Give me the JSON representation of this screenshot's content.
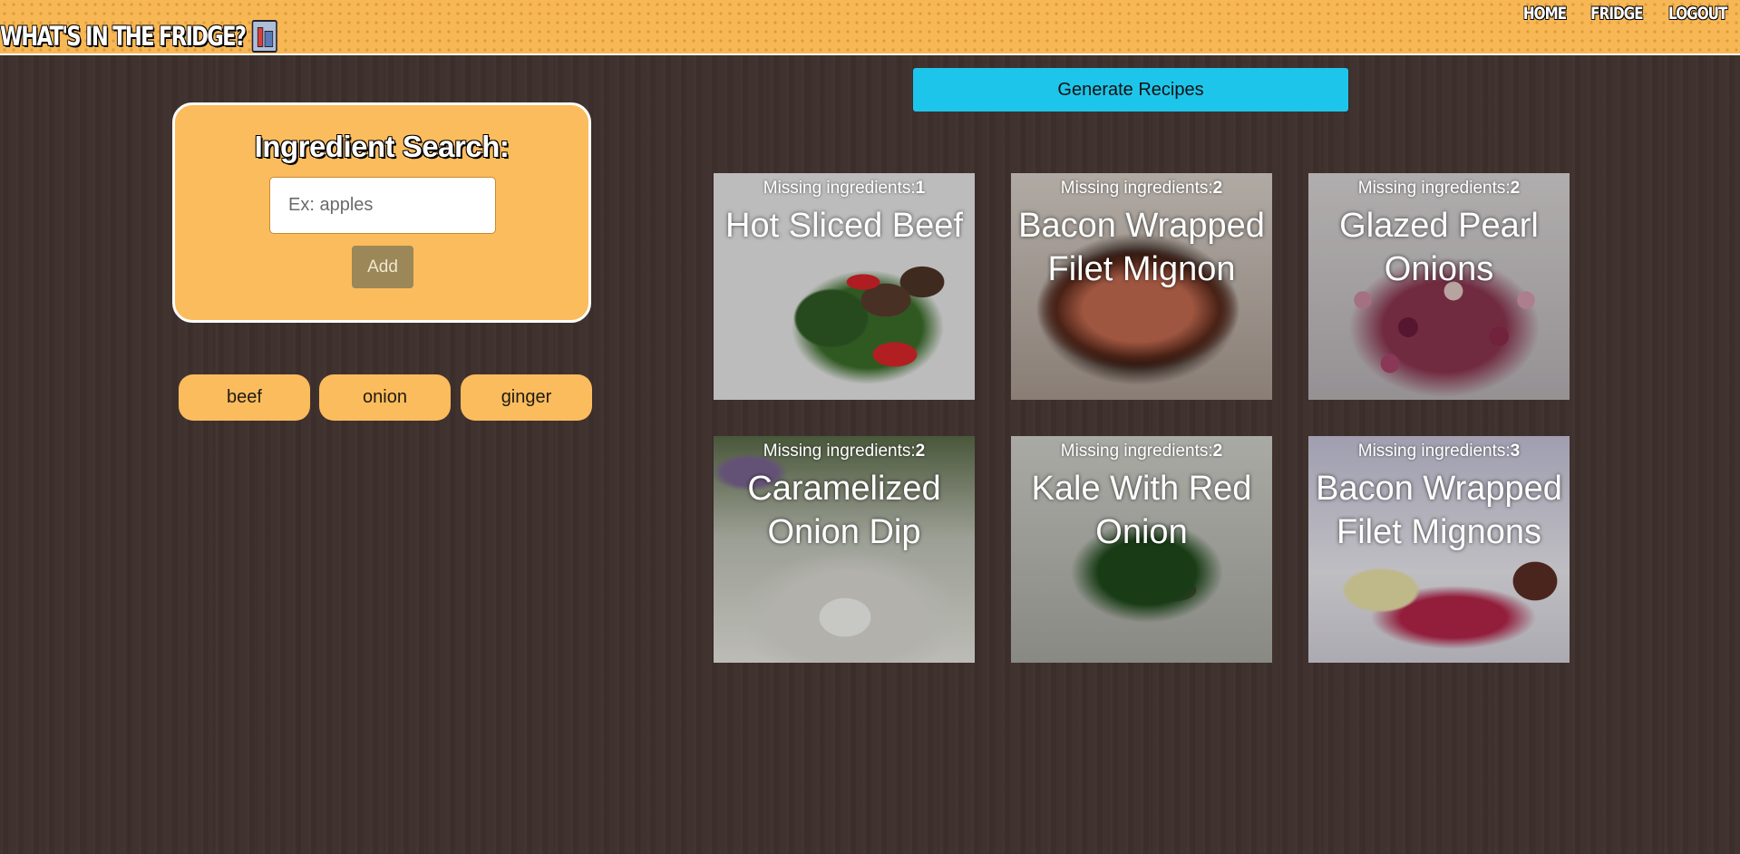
{
  "header": {
    "brand": "WHAT'S IN THE FRIDGE?",
    "nav": [
      {
        "label": "HOME"
      },
      {
        "label": "FRIDGE"
      },
      {
        "label": "LOGOUT"
      }
    ]
  },
  "search": {
    "title": "Ingredient Search:",
    "placeholder": "Ex: apples",
    "value": "",
    "add_label": "Add"
  },
  "ingredients": [
    "beef",
    "onion",
    "ginger"
  ],
  "generate_label": "Generate Recipes",
  "recipes": [
    {
      "missing_label": "Missing ingredients:",
      "missing_count": "1",
      "title": "Hot Sliced Beef"
    },
    {
      "missing_label": "Missing ingredients:",
      "missing_count": "2",
      "title": "Bacon Wrapped Filet Mignon"
    },
    {
      "missing_label": "Missing ingredients:",
      "missing_count": "2",
      "title": "Glazed Pearl Onions"
    },
    {
      "missing_label": "Missing ingredients:",
      "missing_count": "2",
      "title": "Caramelized Onion Dip"
    },
    {
      "missing_label": "Missing ingredients:",
      "missing_count": "2",
      "title": "Kale With Red Onion"
    },
    {
      "missing_label": "Missing ingredients:",
      "missing_count": "3",
      "title": "Bacon Wrapped Filet Mignons"
    }
  ],
  "colors": {
    "accent": "#fbbc5d",
    "generate_button": "#1ec5ea",
    "background": "#3e302c"
  },
  "icons": {
    "brand_icon": "fridge-icon"
  }
}
